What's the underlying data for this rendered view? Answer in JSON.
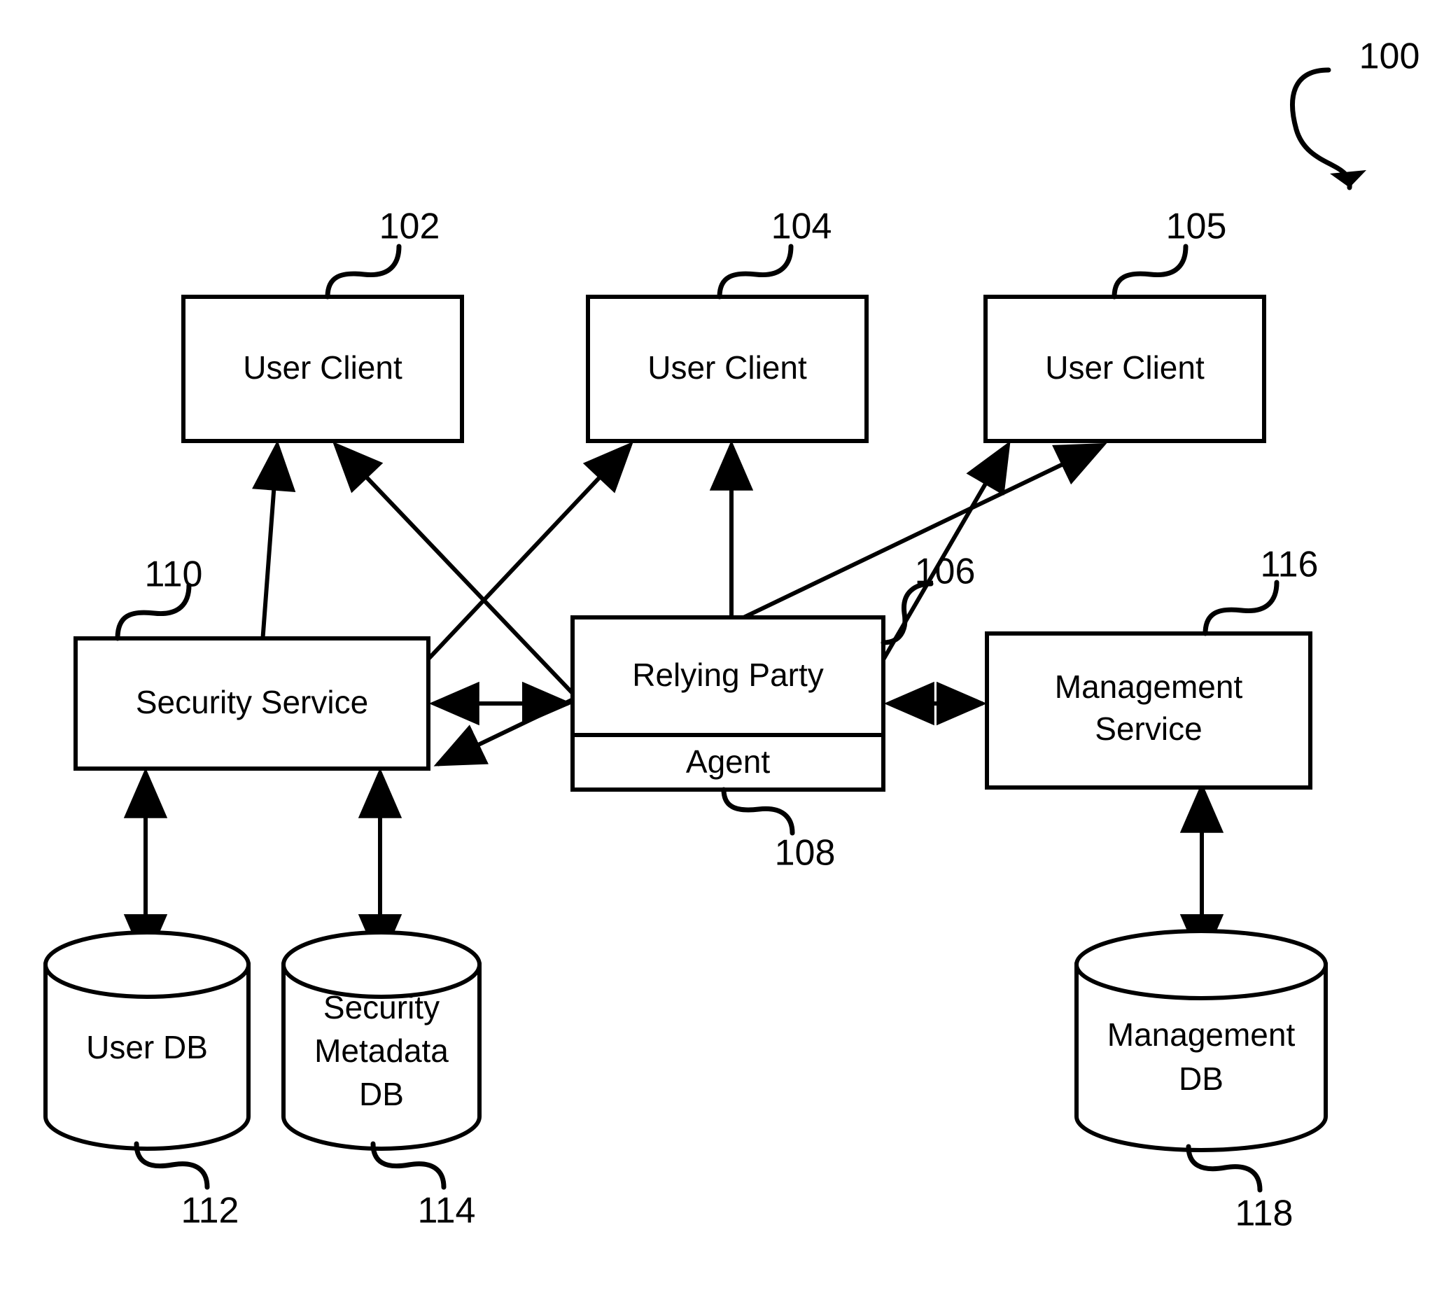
{
  "figure": {
    "label": "100",
    "background_color": "#ffffff",
    "line_color": "#000000"
  },
  "nodes": {
    "user_client_1": {
      "label": "User Client",
      "ref": "102"
    },
    "user_client_2": {
      "label": "User Client",
      "ref": "104"
    },
    "user_client_3": {
      "label": "User Client",
      "ref": "105"
    },
    "security_service": {
      "label": "Security Service",
      "ref": "110"
    },
    "relying_party": {
      "label": "Relying Party",
      "ref": "106"
    },
    "agent": {
      "label": "Agent",
      "ref": "108"
    },
    "management_service": {
      "label_line1": "Management",
      "label_line2": "Service",
      "ref": "116"
    },
    "user_db": {
      "label": "User DB",
      "ref": "112"
    },
    "security_metadata_db": {
      "label_line1": "Security",
      "label_line2": "Metadata",
      "label_line3": "DB",
      "ref": "114"
    },
    "management_db": {
      "label_line1": "Management",
      "label_line2": "DB",
      "ref": "118"
    }
  },
  "connections": [
    {
      "from": "user_client_1",
      "to": "security_service",
      "style": "double-arrow"
    },
    {
      "from": "user_client_1",
      "to": "relying_party",
      "style": "double-arrow"
    },
    {
      "from": "user_client_2",
      "to": "relying_party",
      "style": "double-arrow"
    },
    {
      "from": "user_client_2",
      "to": "security_service",
      "style": "double-arrow"
    },
    {
      "from": "user_client_3",
      "to": "security_service",
      "style": "double-arrow"
    },
    {
      "from": "user_client_3",
      "to": "relying_party",
      "style": "double-arrow"
    },
    {
      "from": "security_service",
      "to": "relying_party",
      "style": "double-arrow"
    },
    {
      "from": "relying_party",
      "to": "management_service",
      "style": "double-arrow"
    },
    {
      "from": "security_service",
      "to": "user_db",
      "style": "double-arrow"
    },
    {
      "from": "security_service",
      "to": "security_metadata_db",
      "style": "double-arrow"
    },
    {
      "from": "management_service",
      "to": "management_db",
      "style": "double-arrow"
    }
  ]
}
